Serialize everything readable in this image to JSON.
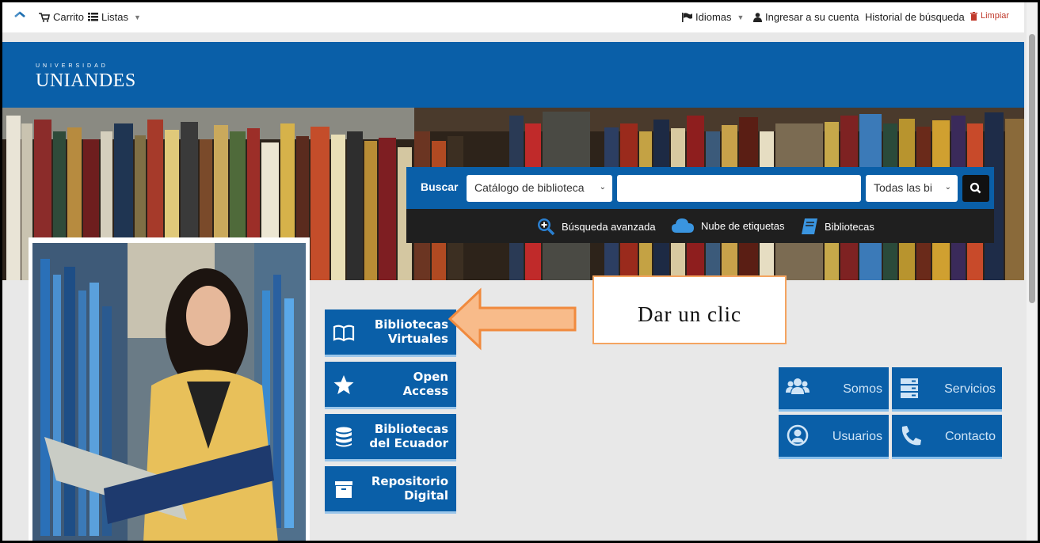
{
  "topbar": {
    "home_icon": "home-icon",
    "cart_label": "Carrito",
    "lists_label": "Listas",
    "languages_label": "Idiomas",
    "login_label": "Ingresar a su cuenta",
    "history_label": "Historial de búsqueda",
    "clear_label": "Limpiar"
  },
  "brand": {
    "small": "UNIVERSIDAD",
    "name": "UNIANDES"
  },
  "search": {
    "label": "Buscar",
    "catalog_value": "Catálogo de biblioteca",
    "query_value": "",
    "library_value": "Todas las bi",
    "links": [
      {
        "label": "Búsqueda avanzada",
        "icon": "zoom-plus-icon"
      },
      {
        "label": "Nube de etiquetas",
        "icon": "cloud-icon"
      },
      {
        "label": "Bibliotecas",
        "icon": "book-icon"
      }
    ]
  },
  "tiles": [
    {
      "line1": "Bibliotecas",
      "line2": "Virtuales",
      "icon": "open-book-icon"
    },
    {
      "line1": "Open",
      "line2": "Access",
      "icon": "star-icon"
    },
    {
      "line1": "Bibliotecas",
      "line2": "del Ecuador",
      "icon": "database-icon"
    },
    {
      "line1": "Repositorio",
      "line2": "Digital",
      "icon": "archive-icon"
    }
  ],
  "callout": {
    "text": "Dar un clic",
    "color": "#f4a460"
  },
  "right_tiles": [
    {
      "label": "Somos",
      "icon": "users-icon"
    },
    {
      "label": "Servicios",
      "icon": "server-icon"
    },
    {
      "label": "Usuarios",
      "icon": "user-circle-icon"
    },
    {
      "label": "Contacto",
      "icon": "phone-icon"
    }
  ],
  "colors": {
    "brand_blue": "#0a5fa8",
    "search_dark": "#1f1f1f"
  }
}
